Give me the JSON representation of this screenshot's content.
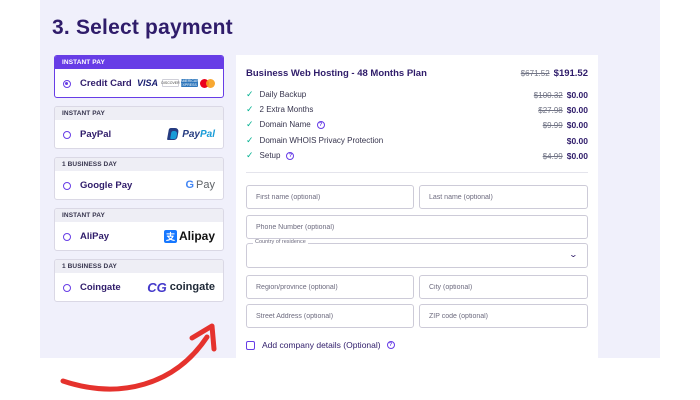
{
  "section_title": "3. Select payment",
  "methods": [
    {
      "badge": "INSTANT PAY",
      "label": "Credit Card",
      "logo": "visa-discover-amex-mastercard"
    },
    {
      "badge": "INSTANT PAY",
      "label": "PayPal",
      "logo": "paypal"
    },
    {
      "badge": "1 BUSINESS DAY",
      "label": "Google Pay",
      "logo": "google-pay"
    },
    {
      "badge": "INSTANT PAY",
      "label": "AliPay",
      "logo": "alipay"
    },
    {
      "badge": "1 BUSINESS DAY",
      "label": "Coingate",
      "logo": "coingate"
    }
  ],
  "logos": {
    "visa": "VISA",
    "discover": "DISCOVER",
    "amex": "AMERICAN EXPRESS",
    "paypal_a": "Pay",
    "paypal_b": "Pal",
    "gpay_g": "G",
    "gpay_text": " Pay",
    "alipay": "Alipay",
    "alipay_mark": "支",
    "coingate": "coingate",
    "coingate_mark": "CG"
  },
  "summary": {
    "title": "Business Web Hosting - 48 Months Plan",
    "old_price": "$671.52",
    "price": "$191.52",
    "items": [
      {
        "label": "Daily Backup",
        "old_price": "$100.32",
        "price": "$0.00",
        "help": false
      },
      {
        "label": "2 Extra Months",
        "old_price": "$27.98",
        "price": "$0.00",
        "help": false
      },
      {
        "label": "Domain Name",
        "old_price": "$9.99",
        "price": "$0.00",
        "help": true
      },
      {
        "label": "Domain WHOIS Privacy Protection",
        "old_price": "",
        "price": "$0.00",
        "help": false
      },
      {
        "label": "Setup",
        "old_price": "$4.99",
        "price": "$0.00",
        "help": true
      }
    ]
  },
  "form": {
    "first_name": "First name (optional)",
    "last_name": "Last name (optional)",
    "phone": "Phone Number (optional)",
    "country_legend": "Country of residence",
    "region": "Region/province (optional)",
    "city": "City (optional)",
    "street": "Street Address (optional)",
    "zip": "ZIP code (optional)",
    "company": "Add company details (Optional)"
  },
  "colors": {
    "accent": "#673de6",
    "title": "#2f1c6a",
    "check": "#00b090",
    "arrow": "#e5322d"
  }
}
